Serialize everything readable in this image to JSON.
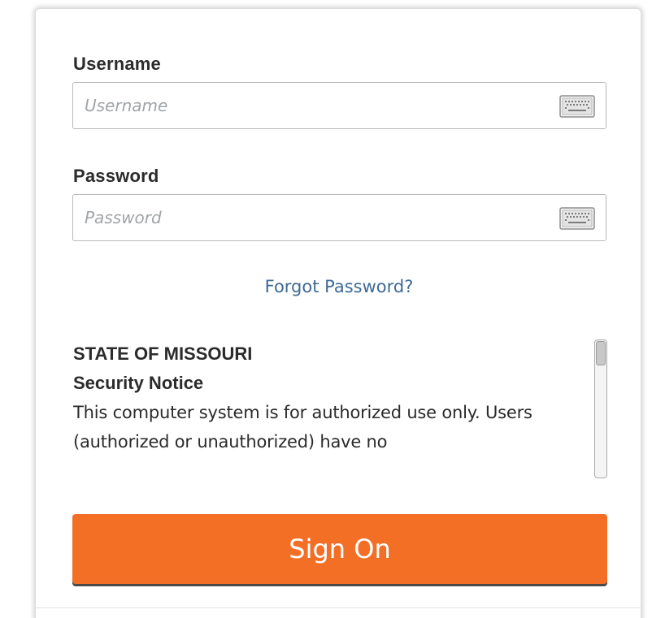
{
  "username": {
    "label": "Username",
    "placeholder": "Username",
    "value": "",
    "keyboard_icon": "keyboard-icon"
  },
  "password": {
    "label": "Password",
    "placeholder": "Password",
    "value": "",
    "keyboard_icon": "keyboard-icon"
  },
  "forgot_password": "Forgot Password?",
  "notice": {
    "org": "STATE OF MISSOURI",
    "heading": "Security Notice",
    "body": "This computer system is for authorized use only. Users (authorized or unauthorized) have no"
  },
  "sign_on_label": "Sign On",
  "colors": {
    "accent": "#f36f26",
    "link": "#3e6a94",
    "text": "#2b2b2b",
    "placeholder": "#a0a4a8"
  }
}
